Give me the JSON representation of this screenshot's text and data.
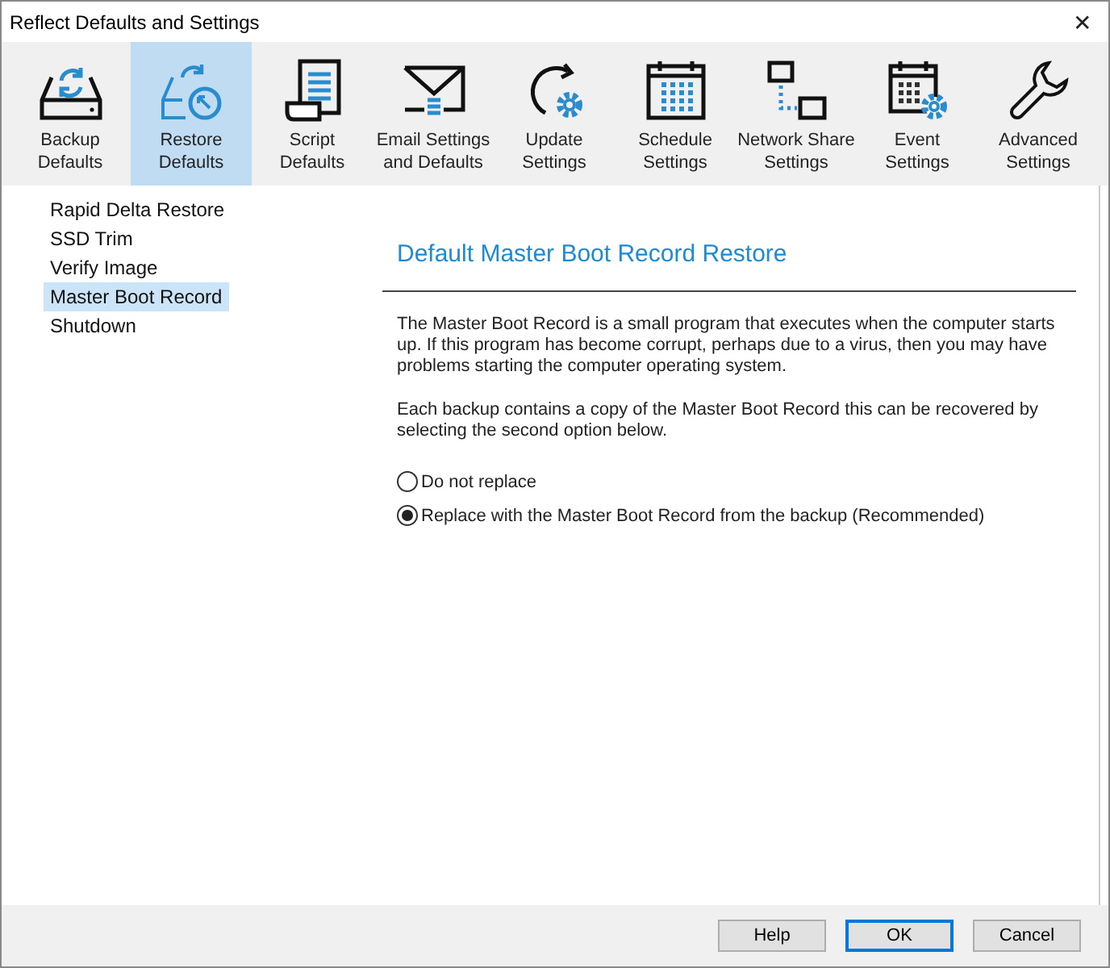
{
  "window": {
    "title": "Reflect Defaults and Settings",
    "close": "✕"
  },
  "toolbar": [
    {
      "label": "Backup\nDefaults",
      "selected": false
    },
    {
      "label": "Restore\nDefaults",
      "selected": true
    },
    {
      "label": "Script\nDefaults",
      "selected": false
    },
    {
      "label": "Email Settings\nand Defaults",
      "selected": false
    },
    {
      "label": "Update\nSettings",
      "selected": false
    },
    {
      "label": "Schedule\nSettings",
      "selected": false
    },
    {
      "label": "Network Share\nSettings",
      "selected": false
    },
    {
      "label": "Event\nSettings",
      "selected": false
    },
    {
      "label": "Advanced\nSettings",
      "selected": false
    }
  ],
  "sidebar": {
    "items": [
      {
        "label": "Rapid Delta Restore",
        "selected": false
      },
      {
        "label": "SSD Trim",
        "selected": false
      },
      {
        "label": "Verify Image",
        "selected": false
      },
      {
        "label": "Master Boot Record",
        "selected": true
      },
      {
        "label": "Shutdown",
        "selected": false
      }
    ]
  },
  "panel": {
    "heading": "Default Master Boot Record Restore",
    "paragraphs": [
      "The Master Boot Record is a small program that executes when the computer starts up. If this program has become corrupt, perhaps due to a virus, then you may have problems starting the computer operating system.",
      "Each backup contains a copy of the Master Boot Record this can be recovered by selecting the second option below."
    ],
    "options": [
      {
        "label": "Do not replace",
        "selected": false
      },
      {
        "label": "Replace with the Master Boot Record from the backup (Recommended)",
        "selected": true
      }
    ]
  },
  "buttons": [
    {
      "label": "Help",
      "default": false
    },
    {
      "label": "OK",
      "default": true
    },
    {
      "label": "Cancel",
      "default": false
    }
  ]
}
